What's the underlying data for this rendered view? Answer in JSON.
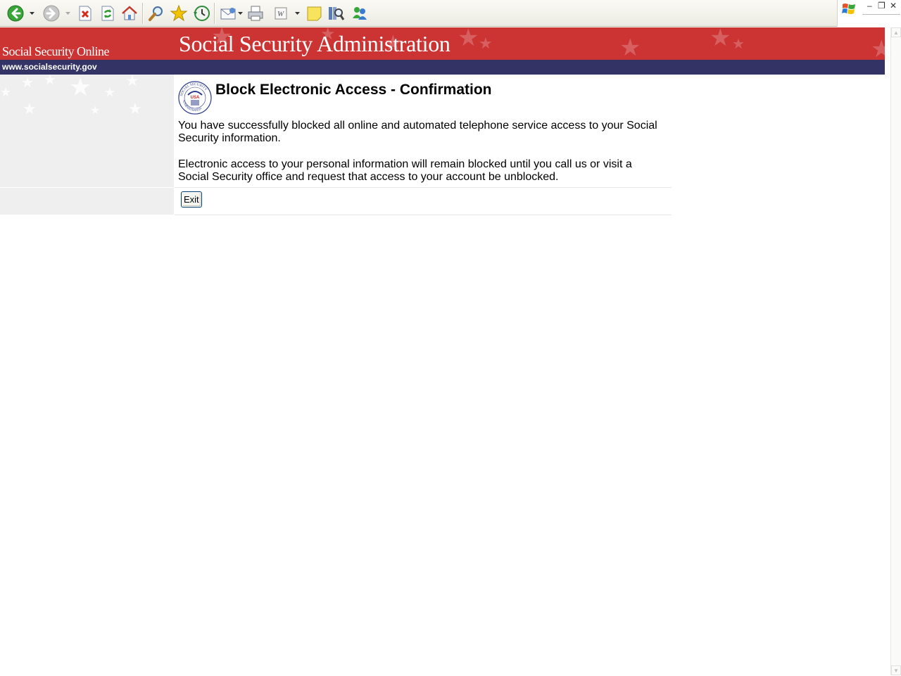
{
  "browser": {
    "toolbar": {
      "buttons": [
        {
          "name": "back",
          "icon": "back-arrow-icon",
          "color": "#2a9a2a"
        },
        {
          "name": "forward",
          "icon": "forward-arrow-icon",
          "color": "#a0a0a0"
        },
        {
          "name": "stop",
          "icon": "stop-icon",
          "color": "#d42a1a"
        },
        {
          "name": "refresh",
          "icon": "refresh-icon",
          "color": "#2f9a2f"
        },
        {
          "name": "home",
          "icon": "home-icon"
        },
        {
          "name": "search",
          "icon": "search-icon"
        },
        {
          "name": "favorites",
          "icon": "favorites-star-icon",
          "color": "#f2c300"
        },
        {
          "name": "history",
          "icon": "history-icon"
        },
        {
          "name": "mail",
          "icon": "mail-icon"
        },
        {
          "name": "print",
          "icon": "print-icon"
        },
        {
          "name": "edit",
          "icon": "word-edit-icon"
        },
        {
          "name": "discuss",
          "icon": "discuss-note-icon",
          "color": "#f7e45c"
        },
        {
          "name": "research",
          "icon": "research-icon"
        },
        {
          "name": "messenger",
          "icon": "messenger-icon"
        }
      ]
    },
    "window_controls": [
      "minimize-icon",
      "restore-icon",
      "close-icon"
    ]
  },
  "page": {
    "banner": {
      "site_name": "Social Security Online",
      "agency_title": "Social Security Administration",
      "url_text": "www.socialsecurity.gov",
      "banner_color": "#cc3333",
      "url_bar_color": "#333366"
    },
    "seal": {
      "icon": "ssa-seal-icon",
      "text_top": "SOCIAL SECURITY",
      "text_center": "USA",
      "text_bottom": "ADMINISTRATION"
    },
    "heading": "Block Electronic Access - Confirmation",
    "paragraphs": [
      "You have successfully blocked all online and automated telephone service access to your Social Security information.",
      "Electronic access to your personal information will remain blocked until you call us or visit a Social Security office and request that access to your account be unblocked."
    ],
    "exit_button": "Exit"
  }
}
